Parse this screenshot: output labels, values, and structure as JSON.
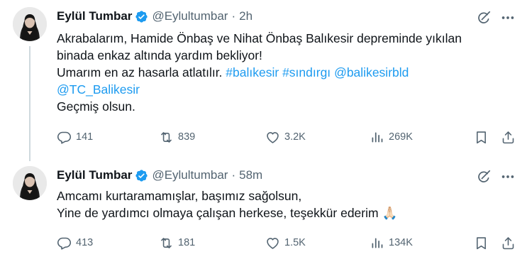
{
  "colors": {
    "link": "#1d9bf0",
    "muted": "#536471",
    "text": "#0f1419",
    "verified": "#1d9bf0",
    "thread_line": "#cfd9de"
  },
  "tweets": [
    {
      "author_name": "Eylül Tumbar",
      "handle": "@Eylultumbar",
      "separator": "·",
      "time": "2h",
      "lines": [
        [
          {
            "text": "Akrabalarım, Hamide Önbaş ve Nihat Önbaş Balıkesir depreminde yıkılan",
            "link": false
          }
        ],
        [
          {
            "text": "binada enkaz altında yardım bekliyor!",
            "link": false
          }
        ],
        [
          {
            "text": "Umarım en az hasarla atlatılır. ",
            "link": false
          },
          {
            "text": "#balıkesir",
            "link": true
          },
          {
            "text": " ",
            "link": false
          },
          {
            "text": "#sındırgı",
            "link": true
          },
          {
            "text": " ",
            "link": false
          },
          {
            "text": "@balikesirbld",
            "link": true
          }
        ],
        [
          {
            "text": "@TC_Balikesir",
            "link": true
          }
        ],
        [
          {
            "text": "Geçmiş olsun.",
            "link": false
          }
        ]
      ],
      "stats": {
        "replies": "141",
        "reposts": "839",
        "likes": "3.2K",
        "views": "269K"
      }
    },
    {
      "author_name": "Eylül Tumbar",
      "handle": "@Eylultumbar",
      "separator": "·",
      "time": "58m",
      "lines": [
        [
          {
            "text": "Amcamı kurtaramamışlar, başımız sağolsun,",
            "link": false
          }
        ],
        [
          {
            "text": "Yine de yardımcı olmaya çalışan herkese, teşekkür ederim 🙏🏻",
            "link": false
          }
        ]
      ],
      "stats": {
        "replies": "413",
        "reposts": "181",
        "likes": "1.5K",
        "views": "134K"
      }
    }
  ],
  "icons": {
    "verified": "verified-badge-icon",
    "grok": "grok-icon",
    "more": "more-icon",
    "reply": "reply-icon",
    "repost": "repost-icon",
    "like": "like-icon",
    "views": "views-icon",
    "bookmark": "bookmark-icon",
    "share": "share-icon"
  }
}
